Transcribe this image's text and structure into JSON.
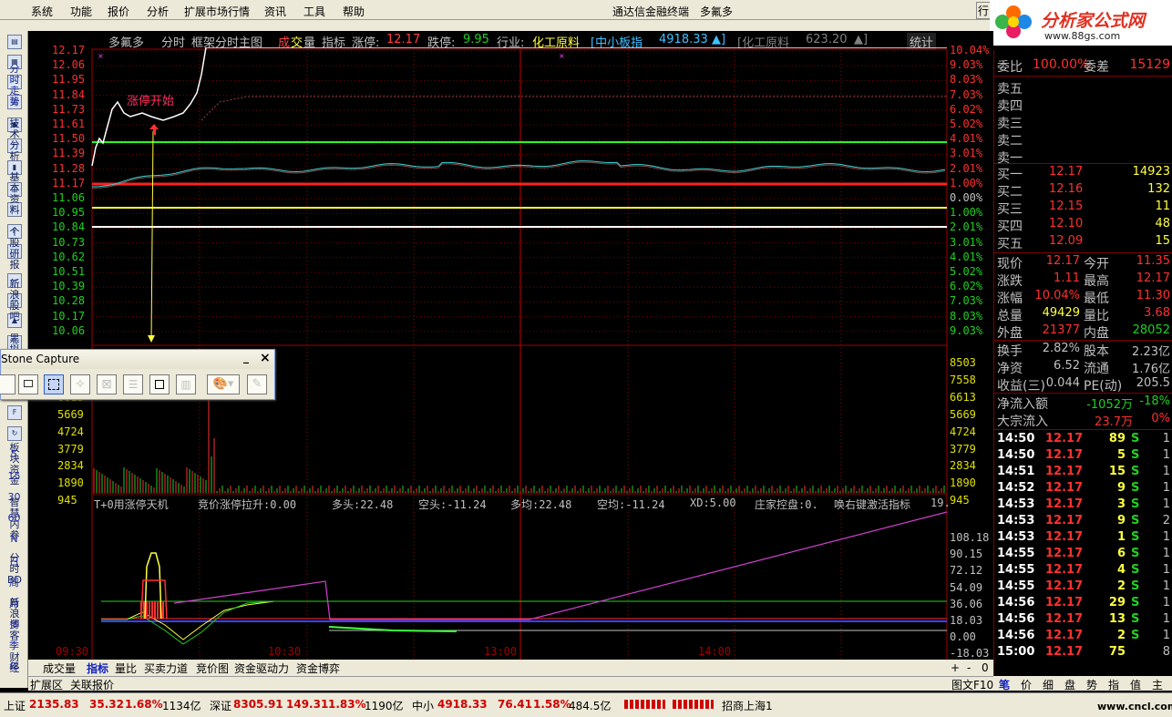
{
  "menu": {
    "items": [
      "系统",
      "功能",
      "报价",
      "分析",
      "扩展市场行情",
      "资讯",
      "工具",
      "帮助"
    ],
    "window_title": "通达信金融终端",
    "stock_title": "多氟多",
    "right_cut": "行"
  },
  "logo": {
    "text": "分析家公式网",
    "url": "www.88gs.com"
  },
  "left_sidebar": {
    "vertical_tabs": [
      "分时走势",
      "技术分析",
      "基本资料",
      "个股研报",
      "新浪股吧",
      "黑拟炒股",
      "板块资金",
      "智慧内参",
      "分时BD",
      "新浪博客",
      "财经"
    ],
    "small_labels": [
      "5",
      "15",
      "30",
      "60",
      "N",
      "日",
      "周",
      "月",
      "多",
      "季",
      "年"
    ],
    "icon_labels": [
      "F5",
      "F10",
      "F12",
      "F7",
      "%"
    ]
  },
  "chart_header": {
    "name": "多氟多",
    "mode": "分时",
    "frame": "框架分时主图",
    "vol_label_a": "成",
    "vol_label_b": "交",
    "vol_label_c": "量",
    "indicator": "指标",
    "limit_up_label": "涨停:",
    "limit_up": "12.17",
    "limit_down_label": "跌停:",
    "limit_down": "9.95",
    "industry_label": "行业:",
    "industry": "化工原料",
    "idx1": "[中小板指",
    "idx1_val": "4918.33",
    "idx1_arrow": "▲]",
    "idx2": "[化工原料",
    "idx2_val": "623.20",
    "idx2_arrow": "▲]",
    "stats": "统计"
  },
  "price_axis": {
    "left": [
      "12.17",
      "12.06",
      "11.95",
      "11.84",
      "11.73",
      "11.61",
      "11.50",
      "11.39",
      "11.28",
      "11.17",
      "11.06",
      "10.95",
      "10.84",
      "10.73",
      "10.62",
      "10.51",
      "10.39",
      "10.28",
      "10.17",
      "10.06"
    ],
    "right": [
      "10.04%",
      "9.03%",
      "8.03%",
      "7.03%",
      "6.02%",
      "5.02%",
      "4.01%",
      "3.01%",
      "2.01%",
      "1.00%",
      "0.00%",
      "1.00%",
      "2.01%",
      "3.01%",
      "4.01%",
      "5.02%",
      "6.02%",
      "7.03%",
      "8.03%",
      "9.03%"
    ]
  },
  "volume_axis": {
    "left": [
      "8503",
      "7558",
      "6613",
      "5669",
      "4724",
      "3779",
      "2834",
      "1890",
      "945"
    ],
    "right": [
      "8503",
      "7558",
      "6613",
      "5669",
      "4724",
      "3779",
      "2834",
      "1890",
      "945"
    ]
  },
  "annotation": {
    "text": "涨停开始"
  },
  "indicator_header": {
    "name": "T+0用涨停天机",
    "items": [
      "竞价涨停拉升:0.00",
      "多头:22.48",
      "空头:-11.24",
      "多均:22.48",
      "空均:-11.24",
      "XD:5.00",
      "庄家控盘:0.",
      "唤右键激活指标"
    ],
    "tail": "19."
  },
  "indicator_axis": [
    "108.18",
    "90.15",
    "72.12",
    "54.09",
    "36.06",
    "18.03",
    "0.00",
    "-18.03"
  ],
  "time_axis": [
    "09:30",
    "10:30",
    "13:00",
    "14:00"
  ],
  "bottom_tabs": [
    "成交量",
    "指标",
    "量比",
    "买卖力道",
    "竞价图",
    "资金驱动力",
    "资金博弈"
  ],
  "bottom_tabs_active": "指标",
  "bottom_extra": [
    "扩展区",
    "关联报价"
  ],
  "bottom_ctrl": [
    "+",
    "-",
    "0"
  ],
  "right_tabs": [
    "笔",
    "价",
    "细",
    "盘",
    "势",
    "指",
    "值",
    "主"
  ],
  "right_tab_prefix": "图文F10",
  "quote": {
    "weibi_label": "委比",
    "weibi": "100.00%",
    "weicha_label": "委差",
    "weicha": "15129",
    "sell": [
      "卖五",
      "卖四",
      "卖三",
      "卖二",
      "卖一"
    ],
    "buy": [
      {
        "label": "买一",
        "price": "12.17",
        "vol": "14923"
      },
      {
        "label": "买二",
        "price": "12.16",
        "vol": "132"
      },
      {
        "label": "买三",
        "price": "12.15",
        "vol": "11"
      },
      {
        "label": "买四",
        "price": "12.10",
        "vol": "48"
      },
      {
        "label": "买五",
        "price": "12.09",
        "vol": "15"
      }
    ],
    "stats": [
      {
        "l1": "现价",
        "v1": "12.17",
        "l2": "今开",
        "v2": "11.35"
      },
      {
        "l1": "涨跌",
        "v1": "1.11",
        "l2": "最高",
        "v2": "12.17"
      },
      {
        "l1": "涨幅",
        "v1": "10.04%",
        "l2": "最低",
        "v2": "11.30"
      },
      {
        "l1": "总量",
        "v1": "49429",
        "l2": "量比",
        "v2": "3.68"
      },
      {
        "l1": "外盘",
        "v1": "21377",
        "l2": "内盘",
        "v2": "28052"
      }
    ],
    "stats2": [
      {
        "l1": "换手",
        "v1": "2.82%",
        "l2": "股本",
        "v2": "2.23亿"
      },
      {
        "l1": "净资",
        "v1": "6.52",
        "l2": "流通",
        "v2": "1.76亿"
      },
      {
        "l1": "收益(三)",
        "v1": "0.044",
        "l2": "PE(动)",
        "v2": "205.5"
      }
    ],
    "flow": [
      {
        "label": "净流入额",
        "value": "-1052万",
        "pct": "-18%"
      },
      {
        "label": "大宗流入",
        "value": "23.7万",
        "pct": "0%"
      }
    ],
    "ticks": [
      {
        "t": "14:50",
        "p": "12.17",
        "v": "89",
        "s": "S",
        "n": "1"
      },
      {
        "t": "14:50",
        "p": "12.17",
        "v": "5",
        "s": "S",
        "n": "1"
      },
      {
        "t": "14:51",
        "p": "12.17",
        "v": "15",
        "s": "S",
        "n": "1"
      },
      {
        "t": "14:52",
        "p": "12.17",
        "v": "9",
        "s": "S",
        "n": "1"
      },
      {
        "t": "14:53",
        "p": "12.17",
        "v": "3",
        "s": "S",
        "n": "1"
      },
      {
        "t": "14:53",
        "p": "12.17",
        "v": "9",
        "s": "S",
        "n": "2"
      },
      {
        "t": "14:53",
        "p": "12.17",
        "v": "1",
        "s": "S",
        "n": "1"
      },
      {
        "t": "14:55",
        "p": "12.17",
        "v": "6",
        "s": "S",
        "n": "1"
      },
      {
        "t": "14:55",
        "p": "12.17",
        "v": "4",
        "s": "S",
        "n": "1"
      },
      {
        "t": "14:55",
        "p": "12.17",
        "v": "2",
        "s": "S",
        "n": "1"
      },
      {
        "t": "14:56",
        "p": "12.17",
        "v": "29",
        "s": "S",
        "n": "1"
      },
      {
        "t": "14:56",
        "p": "12.17",
        "v": "13",
        "s": "S",
        "n": "1"
      },
      {
        "t": "14:56",
        "p": "12.17",
        "v": "2",
        "s": "S",
        "n": "1"
      },
      {
        "t": "15:00",
        "p": "12.17",
        "v": "75",
        "s": "",
        "n": "8"
      }
    ]
  },
  "status": {
    "sh_label": "上证",
    "sh": "2135.83",
    "sh_chg": "35.32",
    "sh_pct": "1.68%",
    "sh_amt": "1134亿",
    "sz_label": "深证",
    "sz": "8305.91",
    "sz_chg": "149.31",
    "sz_pct": "1.83%",
    "sz_amt": "1190亿",
    "zx_label": "中小",
    "zx": "4918.33",
    "zx_chg": "76.41",
    "zx_pct": "1.58%",
    "zx_amt": "484.5亿",
    "broker": "招商上海1",
    "watermark": "www.cncl.com"
  },
  "capture_window": {
    "title": "Stone Capture",
    "min": "_",
    "close": "×"
  },
  "colors": {
    "up": "#ff3030",
    "down": "#20d020",
    "price_line": "#ffffff",
    "avg_line": "#e0e000",
    "limit_line": "#ff2020",
    "green_line": "#20ff20",
    "menu_bg": "#ece9d8",
    "axis_border": "#a00000"
  }
}
